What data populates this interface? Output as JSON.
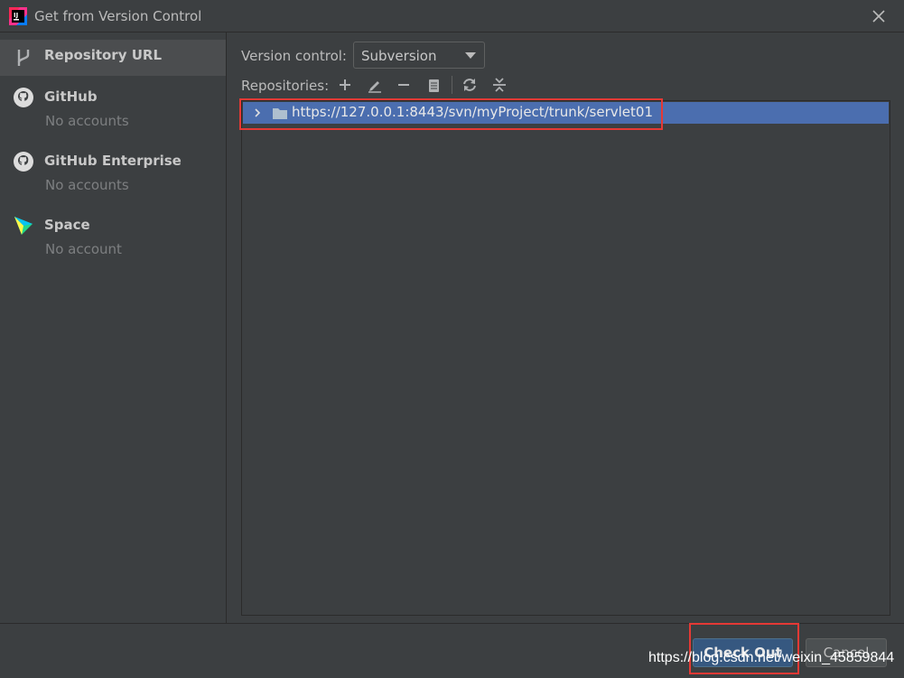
{
  "window": {
    "title": "Get from Version Control"
  },
  "sidebar": {
    "items": [
      {
        "label": "Repository URL",
        "sub": ""
      },
      {
        "label": "GitHub",
        "sub": "No accounts"
      },
      {
        "label": "GitHub Enterprise",
        "sub": "No accounts"
      },
      {
        "label": "Space",
        "sub": "No account"
      }
    ]
  },
  "main": {
    "version_control_label": "Version control:",
    "version_control_value": "Subversion",
    "repositories_label": "Repositories:",
    "tree": [
      {
        "label": "https://127.0.0.1:8443/svn/myProject/trunk/servlet01",
        "selected": true
      }
    ]
  },
  "footer": {
    "checkout_label": "Check Out",
    "cancel_label": "Cancel"
  },
  "watermark": "https://blog.csdn.net/weixin_45859844",
  "colors": {
    "background": "#3c3f41",
    "selection": "#4b6eaf",
    "primary_button": "#365880",
    "annotation": "#e53935"
  }
}
